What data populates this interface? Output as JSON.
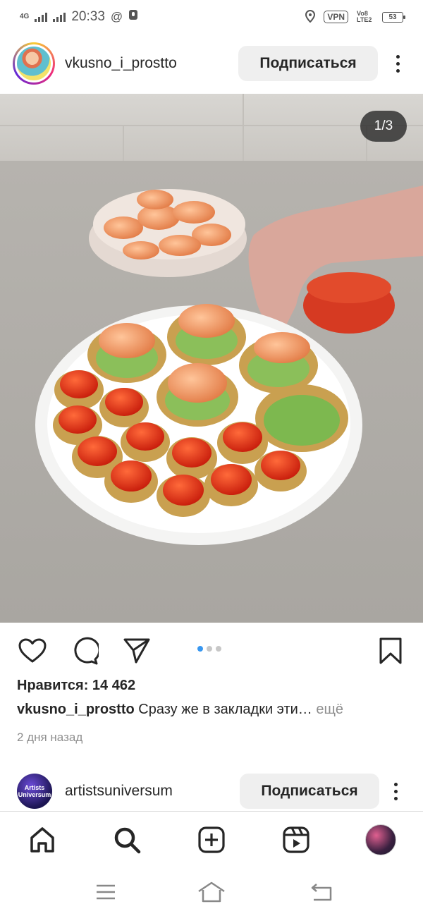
{
  "status_bar": {
    "network": "4G",
    "time": "20:33",
    "vpn": "VPN",
    "volte": "Vo8 LTE2",
    "battery": "53"
  },
  "post": {
    "username": "vkusno_i_prostto",
    "follow_label": "Подписаться",
    "image_counter": "1/3",
    "likes_text": "Нравится: 14 462",
    "caption_user": "vkusno_i_prostto",
    "caption_text": "Сразу же в закладки эти…",
    "caption_more": "ещё",
    "timestamp": "2 дня назад",
    "carousel": {
      "total": 3,
      "current": 1
    }
  },
  "next_post": {
    "avatar_text": "Artists Universum",
    "username": "artistsuniversum",
    "follow_label": "Подписаться"
  },
  "icons": {
    "like": "heart-icon",
    "comment": "comment-icon",
    "share": "send-icon",
    "save": "bookmark-icon",
    "home": "home-icon",
    "search": "search-icon",
    "new_post": "add-icon",
    "reels": "reels-icon"
  },
  "colors": {
    "accent_blue": "#3897f0",
    "button_bg": "#efefef",
    "text": "#262626",
    "muted": "#8e8e8e"
  }
}
